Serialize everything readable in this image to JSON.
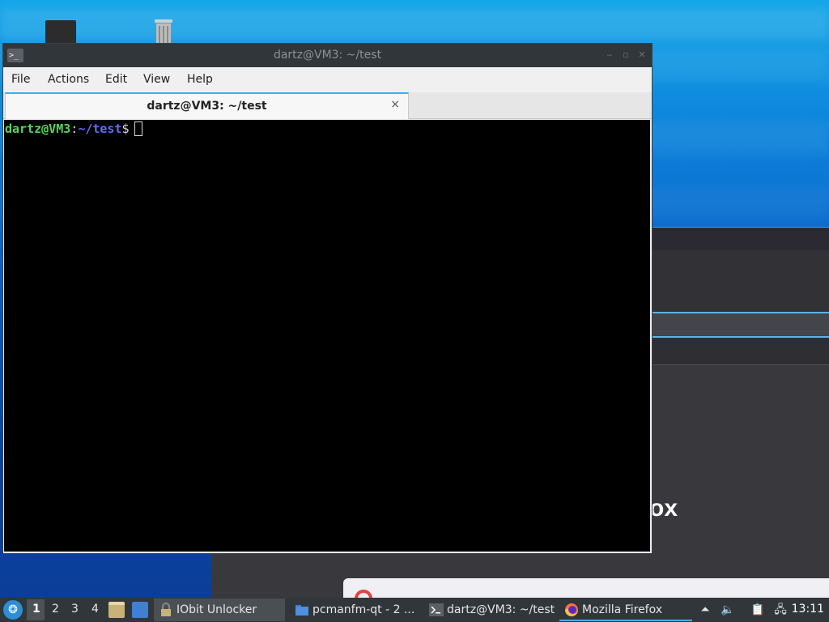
{
  "terminal": {
    "window_title": "dartz@VM3: ~/test",
    "menu": [
      "File",
      "Actions",
      "Edit",
      "View",
      "Help"
    ],
    "tab": {
      "label": "dartz@VM3: ~/test",
      "close": "×"
    },
    "prompt": {
      "user_host": "dartz@VM3",
      "separator": ":",
      "path": "~/test",
      "symbol": "$"
    },
    "icon": "terminal-icon"
  },
  "background_window": {
    "visible_text": "ox"
  },
  "taskbar": {
    "workspaces": [
      "1",
      "2",
      "3",
      "4"
    ],
    "active_workspace": "1",
    "tasks": [
      {
        "label": "IObit Unlocker",
        "icon": "iobit-lock-icon",
        "selected": true
      },
      {
        "label": "pcmanfm-qt - 2 ...",
        "icon": "folder-icon",
        "selected": false
      },
      {
        "label": "dartz@VM3: ~/test",
        "icon": "terminal-icon",
        "selected": false
      },
      {
        "label": "Mozilla Firefox",
        "icon": "firefox-icon",
        "selected": false,
        "active": true
      }
    ],
    "clock": "13:11"
  },
  "colors": {
    "prompt_user": "#55d45a",
    "prompt_path": "#5c6ff0",
    "accent": "#3daee9",
    "taskbar_bg": "#31363b"
  }
}
